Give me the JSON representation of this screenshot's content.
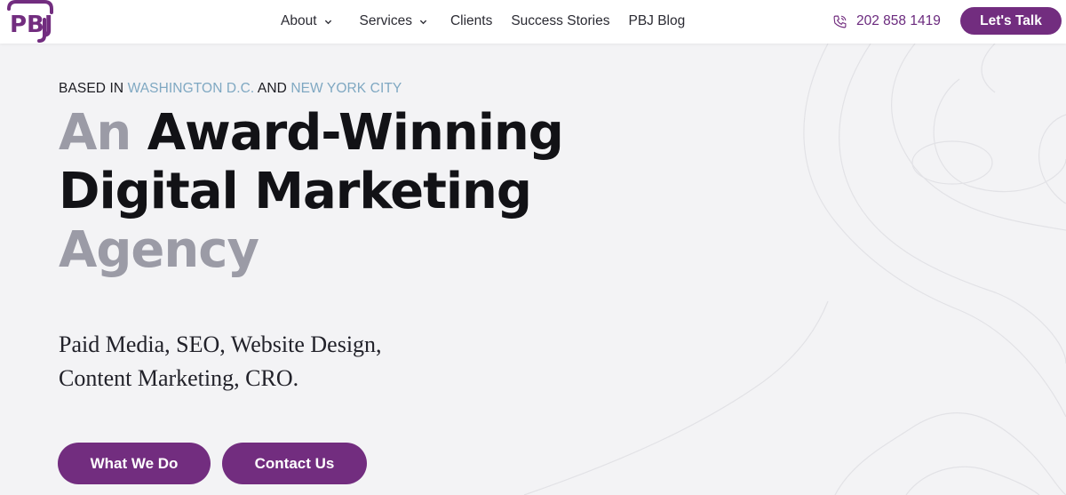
{
  "brand": {
    "logo_text": "PBJ",
    "color": "#722d7f"
  },
  "nav": {
    "items": [
      {
        "label": "About",
        "has_dropdown": true
      },
      {
        "label": "Services",
        "has_dropdown": true
      },
      {
        "label": "Clients",
        "has_dropdown": false
      },
      {
        "label": "Success Stories",
        "has_dropdown": false
      },
      {
        "label": "PBJ Blog",
        "has_dropdown": false
      }
    ]
  },
  "header": {
    "phone": "202 858 1419",
    "phone_icon": "phone-icon",
    "cta_label": "Let's Talk"
  },
  "hero": {
    "based_prefix": "BASED IN",
    "location_1": "WASHINGTON D.C.",
    "based_and": "AND",
    "location_2": "NEW YORK CITY",
    "headline_word_1": "An",
    "headline_line_1": "Award-Winning",
    "headline_line_2": "Digital Marketing",
    "headline_line_3": "Agency",
    "services_line_1": "Paid Media, SEO, Website Design,",
    "services_line_2": "Content Marketing, CRO.",
    "primary_button": "What We Do",
    "secondary_button": "Contact Us"
  },
  "colors": {
    "accent": "#722d7f",
    "location": "#7fa8c2",
    "headline_dark": "#121216",
    "headline_grey": "#9b9ba6",
    "background": "#f3f3f5"
  }
}
